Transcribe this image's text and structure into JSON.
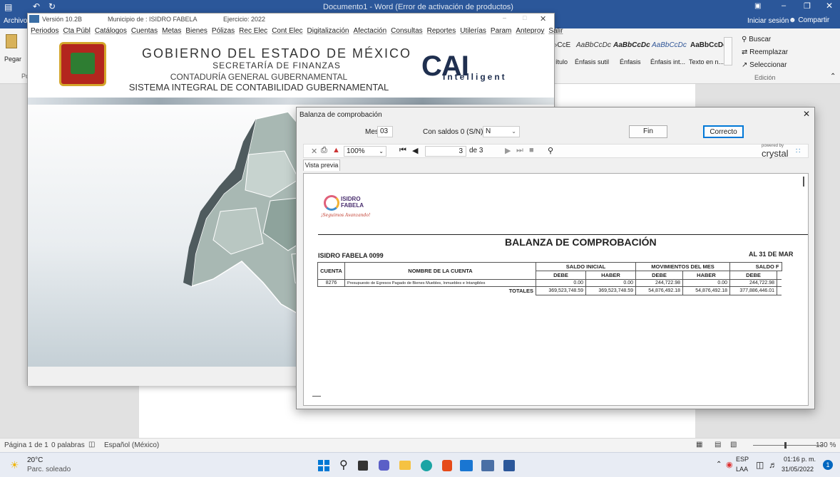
{
  "word": {
    "title": "Documento1 - Word (Error de activación de productos)",
    "file_tab": "Archivo",
    "signin": "Iniciar sesión",
    "share": "Compartir",
    "paste": "Pegar",
    "clipboard_abbr": "Po",
    "styles": [
      "AaBbCcD",
      "AaBbCcDc",
      "AaBbCcDc",
      "AaBbCcDc",
      "AaBbCcDc"
    ],
    "style_partial": "›CcE",
    "style_names": [
      "ítulo",
      "Énfasis sutil",
      "Énfasis",
      "Énfasis int...",
      "Texto en n..."
    ],
    "find": "Buscar",
    "replace": "Reemplazar",
    "select": "Seleccionar",
    "edit_group": "Edición",
    "status_page": "Página 1 de 1",
    "status_words": "0 palabras",
    "status_lang": "Español (México)",
    "zoom": "130 %"
  },
  "cai": {
    "version": "Versión 10.2B",
    "municipio": "Municipio de : ISIDRO FABELA",
    "ejercicio": "Ejercicio: 2022",
    "menu": [
      "Periodos",
      "Cta Públ",
      "Catálogos",
      "Cuentas",
      "Metas",
      "Bienes",
      "Pólizas",
      "Rec Elec",
      "Cont Elec",
      "Digitalización",
      "Afectación",
      "Consultas",
      "Reportes",
      "Utilerías",
      "Param",
      "Anteproy",
      "Salir"
    ],
    "gov_title": "GOBIERNO DEL ESTADO DE MÉXICO",
    "secretaria": "SECRETARÍA DE FINANZAS",
    "contaduria": "CONTADURÍA GENERAL GUBERNAMENTAL",
    "sistema": "SISTEMA INTEGRAL DE CONTABILIDAD GUBERNAMENTAL",
    "logo_main": "CAI",
    "logo_sub": "Intelligent"
  },
  "balanza": {
    "title": "Balanza de comprobación",
    "mes_label": "Mes:",
    "mes_value": "03",
    "saldos_label": "Con saldos 0 (S/N):",
    "saldos_value": "N",
    "fin": "Fin",
    "correcto": "Correcto",
    "zoom": "100%",
    "page": "3",
    "of_pages": "de 3",
    "crystal_powered": "powered by",
    "crystal": "crystal",
    "tab": "Vista previa"
  },
  "report": {
    "logo_name": "ISIDRO FABELA",
    "logo_slogan": "¡Seguimos Avanzando!",
    "title": "BALANZA DE COMPROBACIÓN",
    "entity": "ISIDRO FABELA 0099",
    "date": "AL 31 DE MAR",
    "col_cuenta": "CUENTA",
    "col_nombre": "NOMBRE DE LA CUENTA",
    "grp_inicial": "SALDO INICIAL",
    "grp_mov": "MOVIMIENTOS DEL MES",
    "grp_final": "SALDO F",
    "debe": "DEBE",
    "haber": "HABER",
    "row": {
      "cuenta": "8276",
      "nombre": "Presupuesto de Egresos Pagado de Bienes Muebles, Inmuebles e Intangibles",
      "v1": "0.00",
      "v2": "0.00",
      "v3": "244,722.98",
      "v4": "0.00",
      "v5": "244,722.98"
    },
    "totales_label": "TOTALES",
    "totales": [
      "369,523,748.59",
      "369,523,748.59",
      "54,876,492.18",
      "54,876,492.18",
      "377,886,446.01"
    ]
  },
  "taskbar": {
    "temp": "20°C",
    "weather": "Parc. soleado",
    "lang1": "ESP",
    "lang2": "LAA",
    "time": "01:16 p. m.",
    "date": "31/05/2022",
    "notif": "1"
  }
}
